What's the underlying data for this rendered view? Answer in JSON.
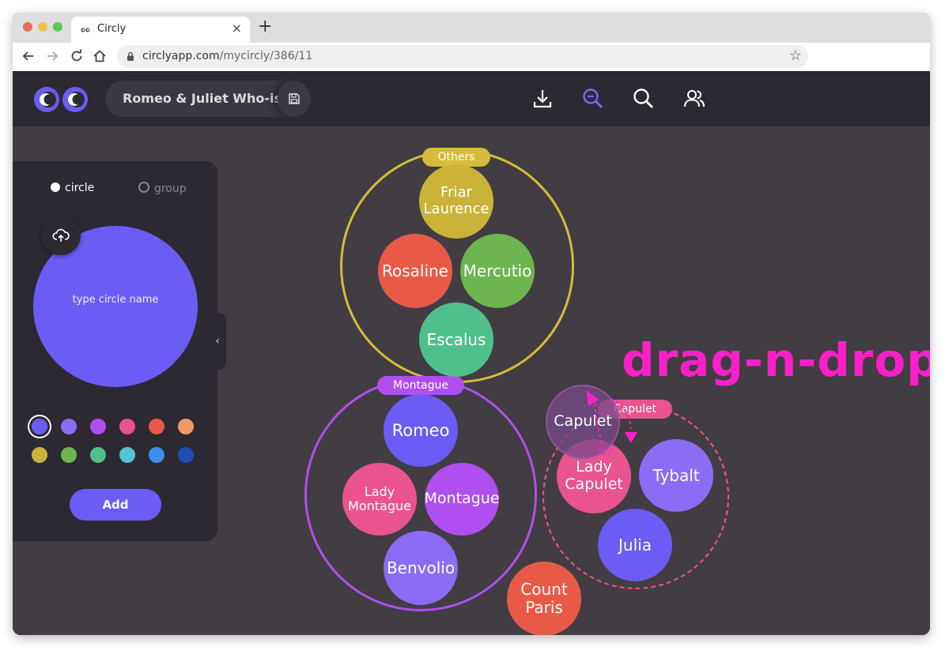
{
  "browser": {
    "tab_title": "Circly",
    "new_tab": "+",
    "close": "×",
    "url_domain": "circlyapp.com",
    "url_path": "/mycircly/386/11"
  },
  "app": {
    "project_title": "Romeo & Juliet Who-is-who",
    "header_icons": [
      "download-icon",
      "zoom-out-icon",
      "zoom-in-icon",
      "users-icon"
    ]
  },
  "panel": {
    "mode_options": [
      "circle",
      "group"
    ],
    "selected_mode": "circle",
    "name_placeholder": "type circle name",
    "preview_color": "#6b5cf5",
    "colors": [
      "#6b5cf5",
      "#8b6cf5",
      "#b04ff0",
      "#e9548e",
      "#e85a47",
      "#f09a63",
      "#cbb33a",
      "#6db54e",
      "#4fc08d",
      "#56c2d6",
      "#3b8ff0",
      "#1e4db5"
    ],
    "selected_color": "#6b5cf5",
    "add_label": "Add",
    "collapse": "‹"
  },
  "groups": [
    {
      "name": "Others",
      "color": "#d3bd3b"
    },
    {
      "name": "Montague",
      "color": "#b04ff0"
    },
    {
      "name": "Capulet",
      "color": "#e9548e"
    }
  ],
  "circles": [
    {
      "name": "Friar Laurence",
      "color": "#cbb33a",
      "group": "Others"
    },
    {
      "name": "Rosaline",
      "color": "#e85a47",
      "group": "Others"
    },
    {
      "name": "Mercutio",
      "color": "#6db54e",
      "group": "Others"
    },
    {
      "name": "Escalus",
      "color": "#4fc08d",
      "group": "Others"
    },
    {
      "name": "Romeo",
      "color": "#6b5cf5",
      "group": "Montague"
    },
    {
      "name": "Lady Montague",
      "color": "#e9548e",
      "group": "Montague"
    },
    {
      "name": "Montague",
      "color": "#b04ff0",
      "group": "Montague"
    },
    {
      "name": "Benvolio",
      "color": "#8b6cf5",
      "group": "Montague"
    },
    {
      "name": "Lady Capulet",
      "color": "#e9548e",
      "group": "Capulet"
    },
    {
      "name": "Tybalt",
      "color": "#8b6cf5",
      "group": "Capulet"
    },
    {
      "name": "Julia",
      "color": "#6b5cf5",
      "group": "Capulet"
    },
    {
      "name": "Count Paris",
      "color": "#e85a47",
      "group": ""
    },
    {
      "name": "Capulet",
      "color": "#7a4a8a",
      "group": "",
      "dragging": true
    }
  ],
  "annotation": "drag-n-drop"
}
